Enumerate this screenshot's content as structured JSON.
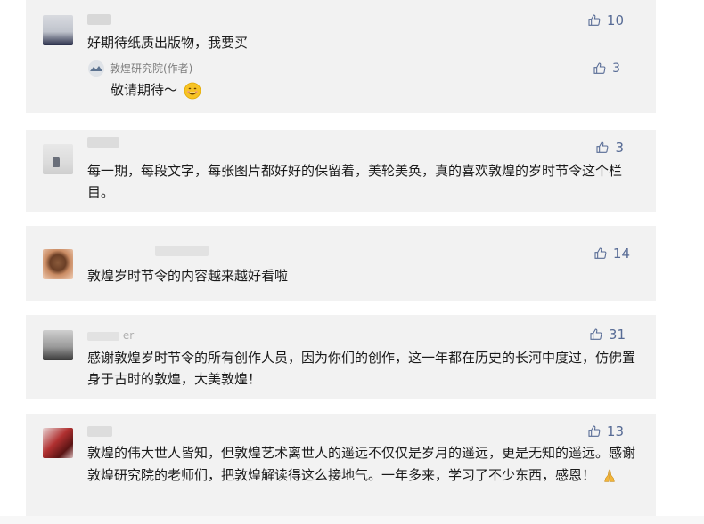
{
  "comments": [
    {
      "nickname": "",
      "text": "好期待纸质出版物，我要买",
      "likes": "10",
      "reply": {
        "author": "敦煌研究院(作者)",
        "text": "敬请期待～",
        "likes": "3"
      }
    },
    {
      "nickname": "",
      "text": "每一期，每段文字，每张图片都好好的保留着，美轮美奂，真的喜欢敦煌的岁时节令这个栏目。",
      "likes": "3"
    },
    {
      "nickname": "",
      "text": "敦煌岁时节令的内容越来越好看啦",
      "likes": "14"
    },
    {
      "nickname": "er",
      "text": "感谢敦煌岁时节令的所有创作人员，因为你们的创作，这一年都在历史的长河中度过，仿佛置身于古时的敦煌，大美敦煌！",
      "likes": "31"
    },
    {
      "nickname": "",
      "text": "敦煌的伟大世人皆知，但敦煌艺术离世人的遥远不仅仅是岁月的遥远，更是无知的遥远。感谢敦煌研究院的老师们，把敦煌解读得这么接地气。一年多来，学习了不少东西，感恩！",
      "likes": "13"
    }
  ],
  "icons": {
    "like": "thumbs-up-icon",
    "smile": "smiling-face-emoji",
    "pray": "folded-hands-emoji"
  },
  "colors": {
    "card_bg": "#f2f2f2",
    "like_color": "#576b95",
    "text": "#1a1a1a"
  }
}
